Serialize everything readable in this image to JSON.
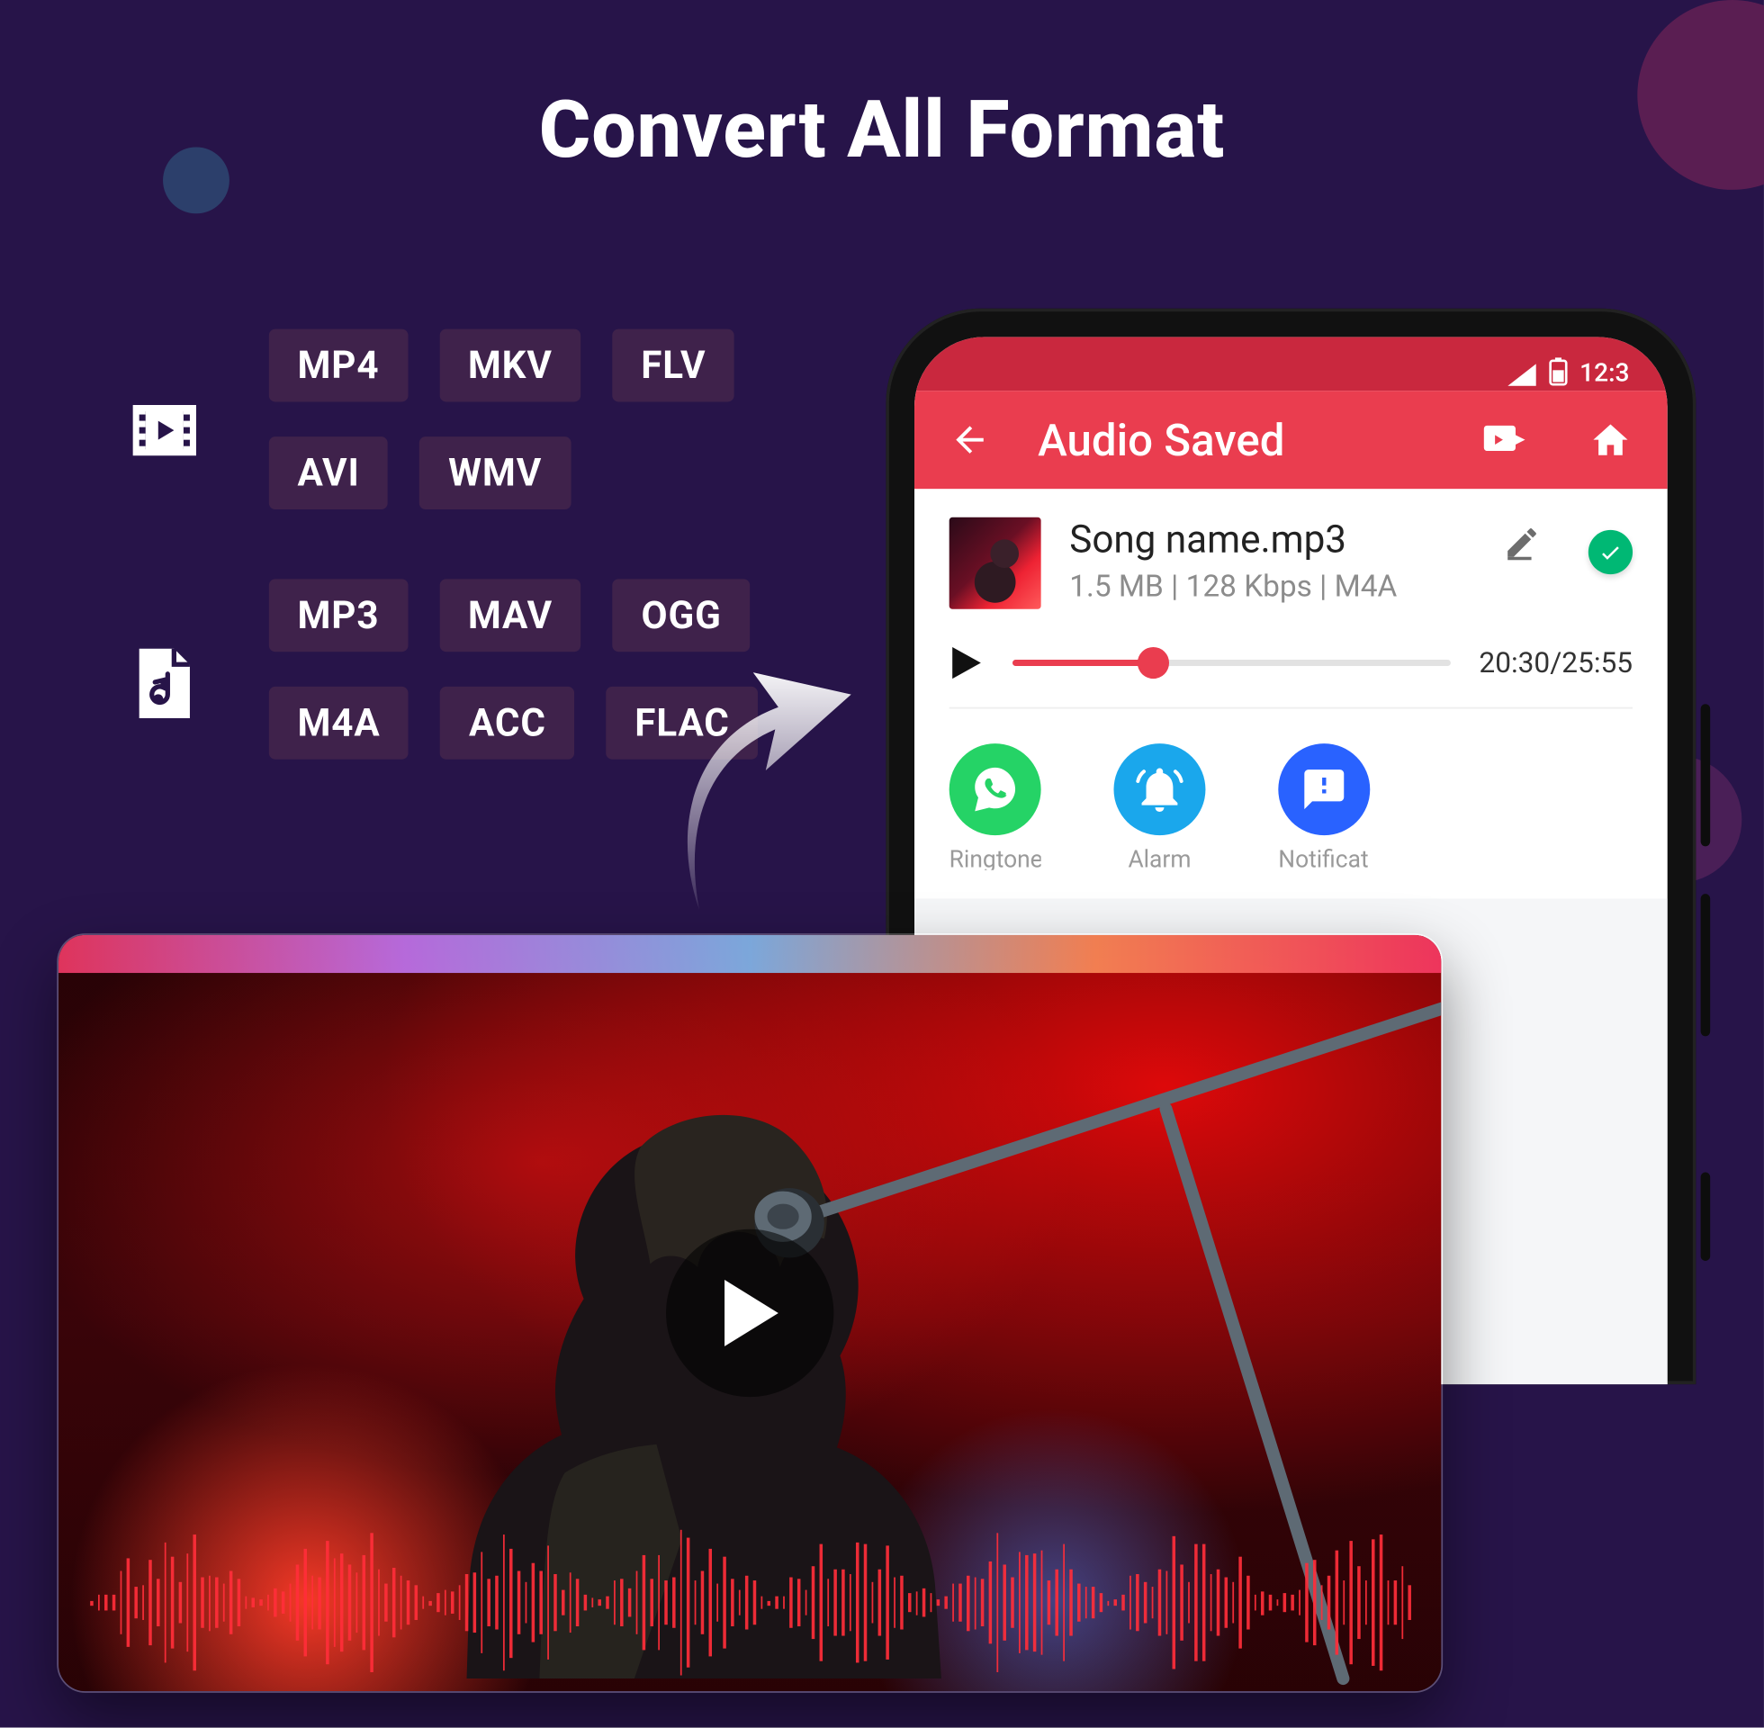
{
  "title": "Convert All Format",
  "video_formats": [
    [
      "MP4",
      "MKV",
      "FLV"
    ],
    [
      "AVI",
      "WMV"
    ]
  ],
  "audio_formats": [
    [
      "MP3",
      "MAV",
      "OGG"
    ],
    [
      "M4A",
      "ACC",
      "FLAC"
    ]
  ],
  "statusbar": {
    "time": "12:3"
  },
  "appbar": {
    "title": "Audio Saved"
  },
  "file": {
    "name": "Song name.mp3",
    "meta": "1.5 MB | 128 Kbps | M4A"
  },
  "player": {
    "progress_pct": 32,
    "time": "20:30/25:55"
  },
  "share_labels": [
    "Ringtone",
    "Alarm",
    "Notification"
  ]
}
